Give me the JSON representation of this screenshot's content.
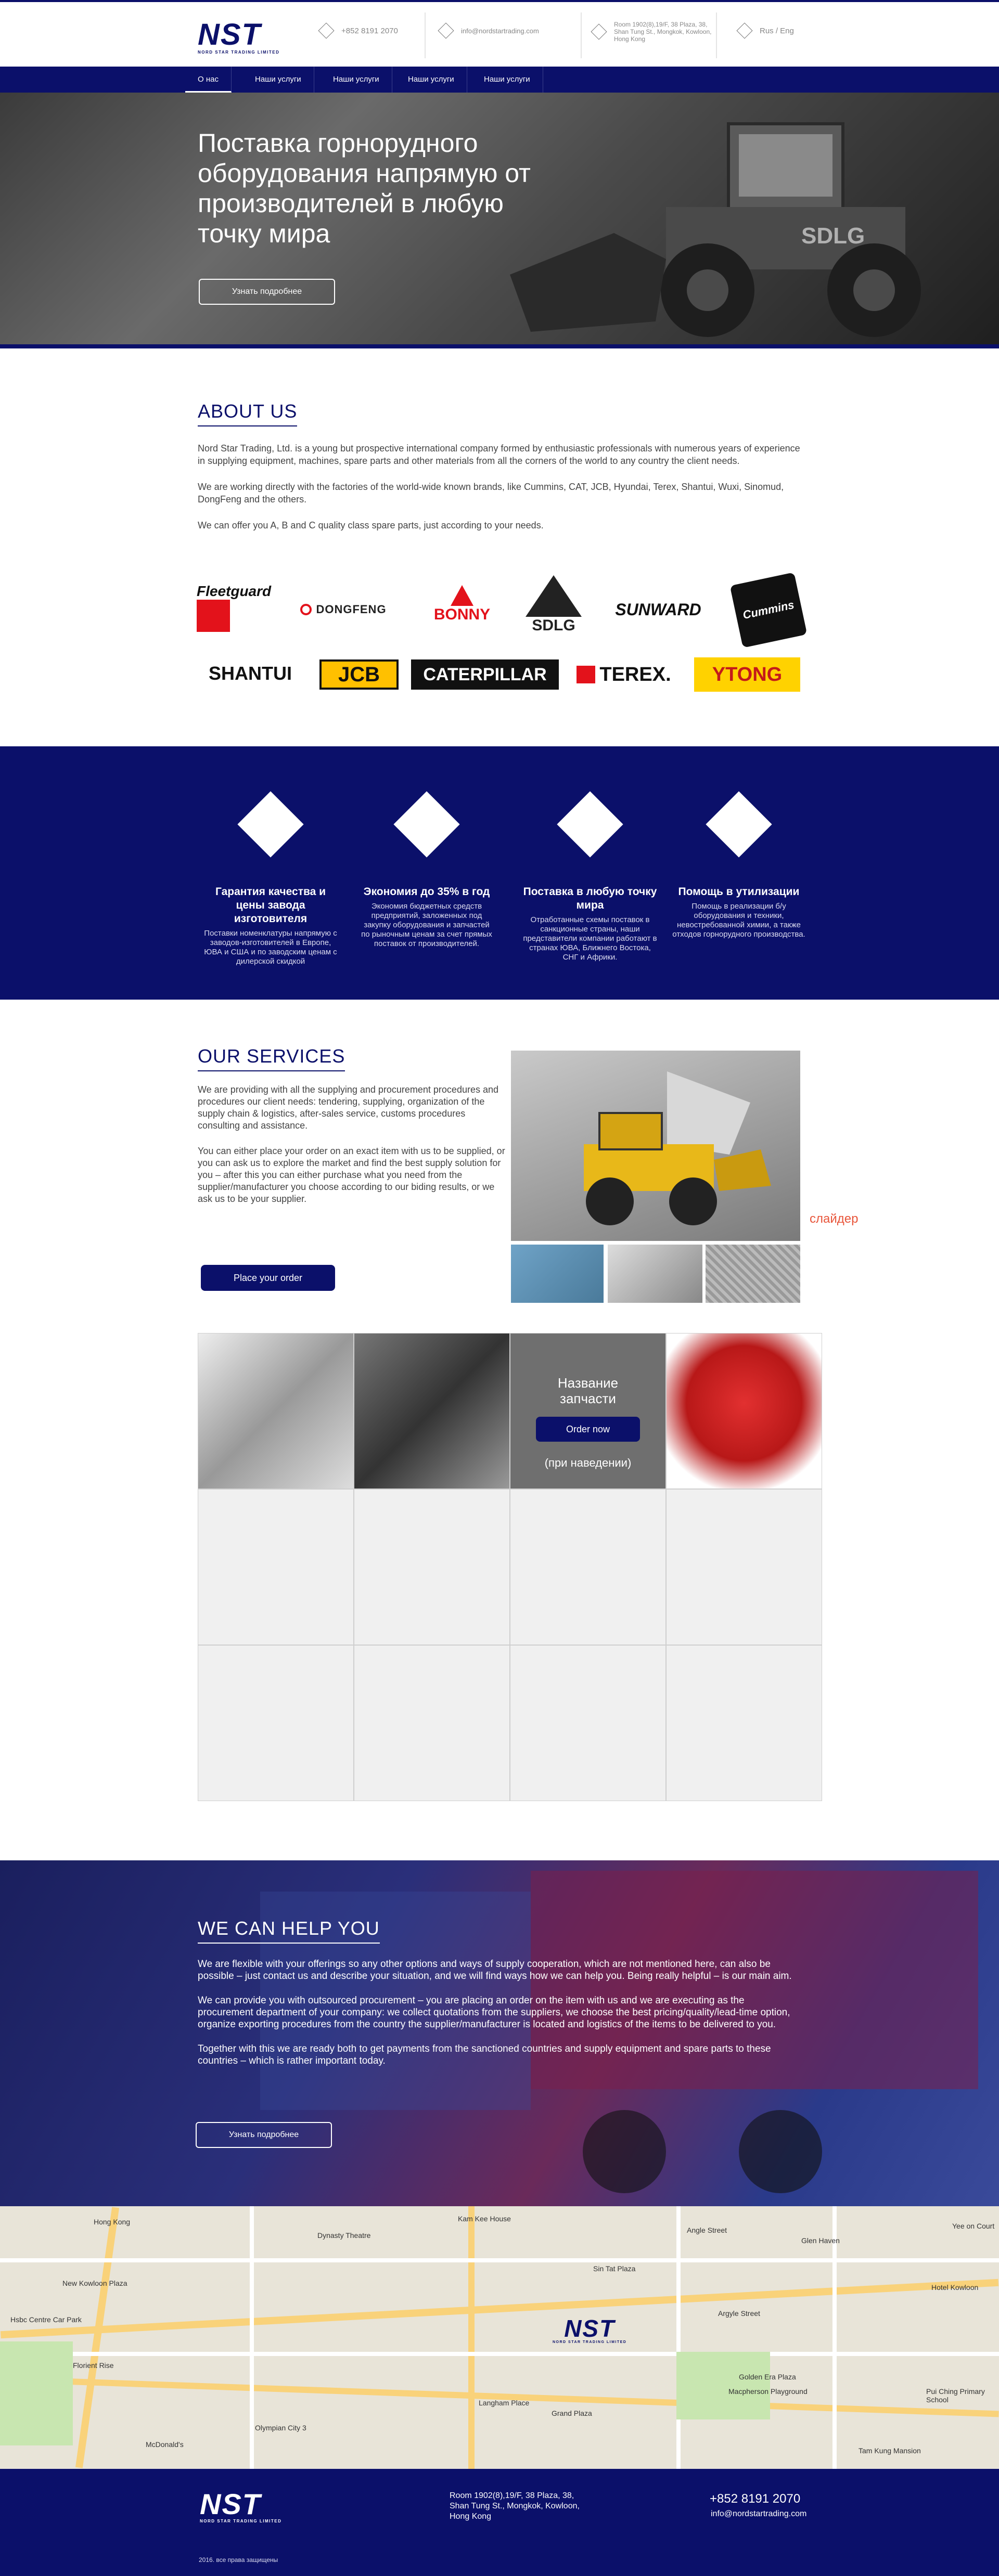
{
  "header": {
    "logo": "NST",
    "logo_sub": "NORD STAR TRADING LIMITED",
    "phone": "+852 8191 2070",
    "email": "info@nordstartrading.com",
    "address": "Room 1902(8),19/F, 38 Plaza, 38, Shan Tung St., Mongkok, Kowloon, Hong Kong",
    "lang": "Rus / Eng"
  },
  "nav": [
    "О нас",
    "Наши услуги",
    "Наши услуги",
    "Наши услуги",
    "Наши услуги"
  ],
  "hero": {
    "title": "Поставка горнорудного оборудования напрямую от производителей в любую точку мира",
    "button": "Узнать подробнее"
  },
  "about": {
    "title": "ABOUT US",
    "p1": "Nord Star Trading, Ltd. is a young but prospective international company formed by enthusiastic professionals with numerous years of experience in supplying equipment, machines, spare parts and other materials from all the corners of the world to any country the client needs.",
    "p2": "We are working directly with the factories of the world-wide known brands, like Cummins, CAT, JCB, Hyundai, Terex, Shantui, Wuxi, Sinomud, DongFeng and the others.",
    "p3": "We can offer you A, B and C quality class spare parts, just according to your needs.",
    "brands": [
      "Fleetguard",
      "DONGFENG",
      "BONNY",
      "SDLG",
      "SUNWARD",
      "Cummins",
      "SHANTUI",
      "JCB",
      "CATERPILLAR",
      "TEREX.",
      "YTONG"
    ]
  },
  "features": [
    {
      "title": "Гарантия качества и цены завода изготовителя",
      "desc": "Поставки номенклатуры напрямую с заводов-изготовителей в Европе, ЮВА и США и по заводским ценам с дилерской скидкой"
    },
    {
      "title": "Экономия до 35% в год",
      "desc": "Экономия бюджетных средств предприятий, заложенных под закупку оборудования и запчастей по рыночным ценам за счет прямых поставок от производителей."
    },
    {
      "title": "Поставка в любую точку мира",
      "desc": "Отработанные схемы поставок в санкционные страны, наши представители компании работают в странах ЮВА, Ближнего Востока, СНГ и Африки."
    },
    {
      "title": "Помощь в утилизации",
      "desc": "Помощь в реализации б/у оборудования и техники, невостребованной химии, а также отходов горнорудного производства."
    }
  ],
  "services": {
    "title": "OUR SERVICES",
    "p1": "We are providing with all the supplying and procurement procedures and procedures our client needs: tendering, supplying, organization of the supply chain & logistics, after-sales service, customs procedures consulting and assistance.",
    "p2": "You can either place your order on an exact item with us to be supplied, or you can ask us to explore the market and find the best supply solution for you – after this you can either purchase what you need from the supplier/manufacturer you choose according to our biding results, or we ask us to be your supplier.",
    "button": "Place your order",
    "slider_note": "слайдер"
  },
  "grid": {
    "hover_title": "Название запчасти",
    "order_button": "Order now",
    "hover_note": "(при наведении)"
  },
  "help": {
    "title": "WE CAN HELP YOU",
    "p1": "We are flexible with your offerings so any other options and ways of supply cooperation, which are not mentioned here, can also be possible – just contact us and describe your situation, and we will find ways how we can help you. Being really helpful – is our main aim.",
    "p2": "We can provide you with outsourced procurement – you are placing an order on the item with us and we are executing as the procurement department of your company: we collect quotations from the suppliers, we choose the best pricing/quality/lead-time option, organize exporting procedures from the country the supplier/manufacturer is located and logistics of the items to be delivered to you.",
    "p3": "Together with this we are ready both to get payments from the sanctioned countries and supply equipment and spare parts to these countries – which is rather important today.",
    "button": "Узнать подробнее"
  },
  "map": {
    "labels": [
      "Hong Kong",
      "Dynasty Theatre",
      "Kam Kee House",
      "Angle Street",
      "Glen Haven",
      "Yee on Court",
      "New Kowloon Plaza",
      "Hsbc Centre Car Park",
      "Sin Tat Plaza",
      "Hotel Kowloon",
      "Florient Rise",
      "Langham Place",
      "Grand Plaza",
      "Golden Era Plaza",
      "Macpherson Playground",
      "Pui Ching Primary School",
      "Olympian City 3",
      "McDonald's",
      "Argyle Street",
      "Tam Kung Mansion"
    ]
  },
  "footer": {
    "address": "Room 1902(8),19/F, 38 Plaza, 38, Shan Tung St., Mongkok, Kowloon, Hong Kong",
    "phone": "+852 8191 2070",
    "email": "info@nordstartrading.com",
    "copyright": "2016. все права защищены"
  }
}
